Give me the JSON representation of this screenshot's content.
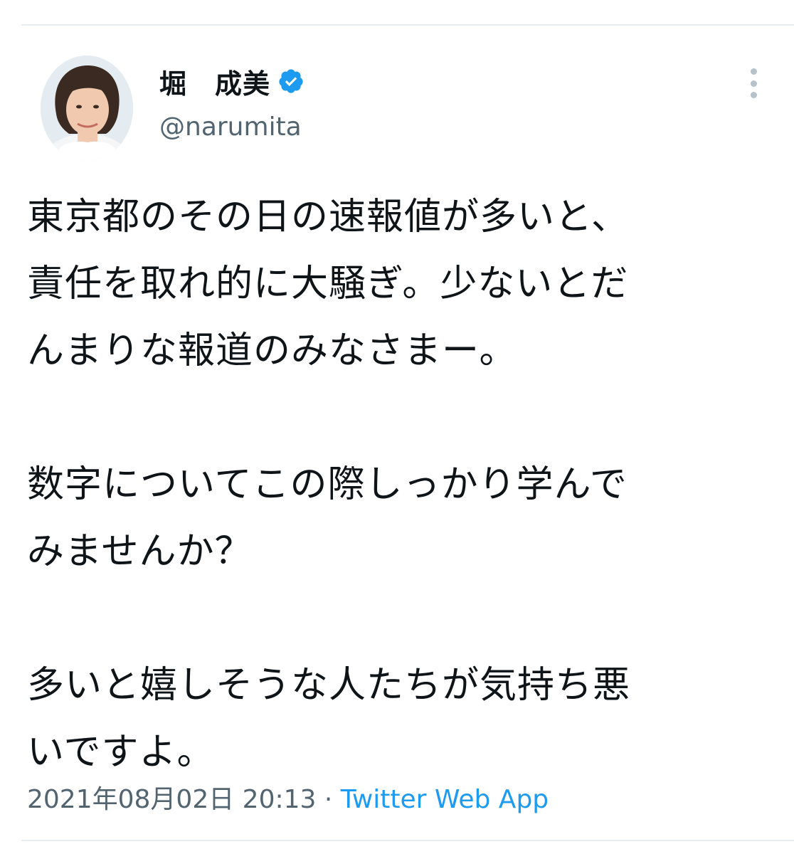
{
  "tweet": {
    "author": {
      "display_name": "堀　成美",
      "handle": "@narumita",
      "verified": true
    },
    "text_lines": [
      "東京都のその日の速報値が多いと、",
      "責任を取れ的に大騒ぎ。少ないとだ",
      "んまりな報道のみなさまー。",
      "",
      "数字についてこの際しっかり学んで",
      "みませんか？",
      "",
      "多いと嬉しそうな人たちが気持ち悪",
      "いですよ。"
    ],
    "timestamp": "2021年08月02日 20:13",
    "separator": " · ",
    "source_app": "Twitter Web App"
  },
  "icons": {
    "verified": "verified-badge-icon",
    "more": "more-vertical-icon"
  },
  "colors": {
    "accent": "#1d9bf0",
    "secondary_text": "#536471",
    "primary_text": "#0f1419"
  }
}
